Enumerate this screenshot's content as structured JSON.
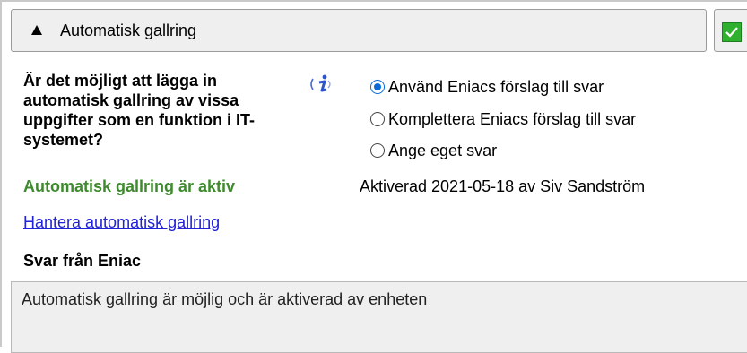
{
  "section": {
    "title": "Automatisk gallring",
    "expanded_icon": "triangle-up-icon",
    "status_icon": "green-check-icon"
  },
  "question": {
    "text": "Är det möjligt att lägga in automatisk gallring av vissa uppgifter som en funktion i IT-systemet?",
    "info_icon": "info-icon"
  },
  "options": [
    {
      "label": "Använd Eniacs förslag till svar",
      "selected": true
    },
    {
      "label": "Komplettera Eniacs förslag till svar",
      "selected": false
    },
    {
      "label": "Ange eget svar",
      "selected": false
    }
  ],
  "status": {
    "active_label": "Automatisk gallring är aktiv",
    "activated_text": "Aktiverad 2021-05-18 av Siv Sandström"
  },
  "manage_link": "Hantera automatisk gallring",
  "answer": {
    "heading": "Svar från Eniac",
    "text": "Automatisk gallring är möjlig och är aktiverad av enheten"
  },
  "colors": {
    "accent": "#0a6ad8",
    "active_green": "#3f8a2f",
    "link": "#2222d8",
    "check_green": "#2fb12f"
  }
}
